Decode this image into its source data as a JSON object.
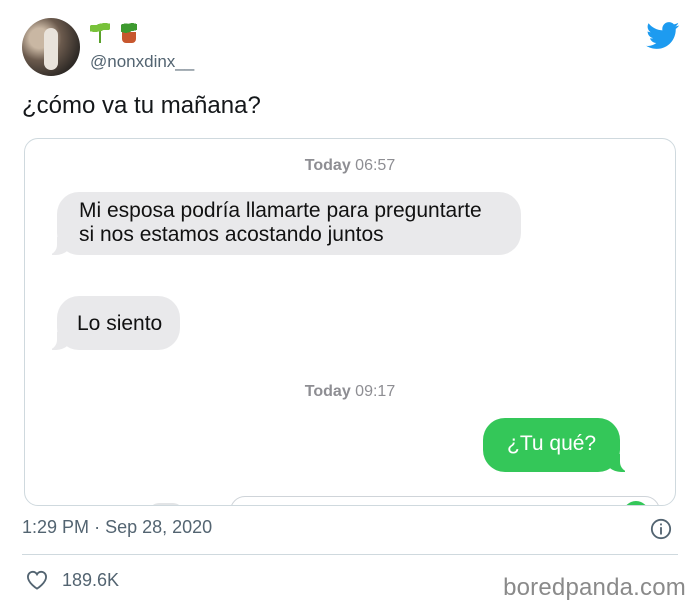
{
  "author": {
    "handle": "@nonxdinx__",
    "emojis": [
      "seedling",
      "potted-plant"
    ]
  },
  "tweet_text": "¿cómo va tu mañana?",
  "conversation": {
    "timestamps": [
      {
        "day": "Today",
        "time": "06:57"
      },
      {
        "day": "Today",
        "time": "09:17"
      }
    ],
    "messages": [
      {
        "direction": "received",
        "text": "Mi esposa podría llamarte para preguntarte si nos estamos acostando juntos"
      },
      {
        "direction": "received",
        "text": "Lo siento"
      },
      {
        "direction": "sent",
        "text": "¿Tu qué?"
      }
    ]
  },
  "meta": {
    "time": "1:29 PM",
    "separator": "·",
    "date": "Sep 28, 2020"
  },
  "likes": "189.6K",
  "watermark": "boredpanda.com",
  "colors": {
    "twitter_blue": "#1d9bf0",
    "sent_bubble": "#34c759",
    "received_bubble": "#e9e9eb",
    "muted_text": "#536471"
  },
  "icons": [
    "twitter-bird-icon",
    "info-icon",
    "heart-icon"
  ]
}
